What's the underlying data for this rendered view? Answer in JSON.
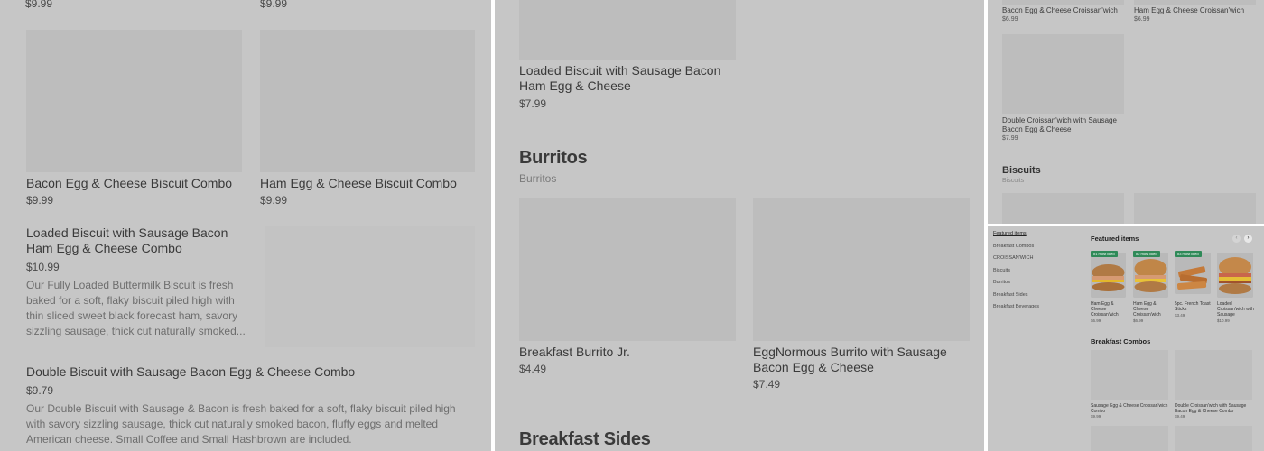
{
  "panel1": {
    "top_prices": [
      "$9.99",
      "$9.99"
    ],
    "items": [
      {
        "name": "Bacon Egg & Cheese Biscuit Combo",
        "price": "$9.99"
      },
      {
        "name": "Ham Egg & Cheese Biscuit Combo",
        "price": "$9.99"
      },
      {
        "name": "Loaded Biscuit with Sausage Bacon Ham Egg & Cheese Combo",
        "price": "$10.99",
        "desc": "Our Fully Loaded Buttermilk Biscuit is fresh baked for a soft, flaky biscuit piled high with thin sliced sweet black forecast ham, savory sizzling sausage, thick cut naturally smoked..."
      },
      {
        "name": "Double Biscuit with Sausage Bacon Egg & Cheese Combo",
        "price": "$9.79",
        "desc": "Our Double Biscuit with Sausage & Bacon is fresh baked for a soft, flaky biscuit piled high with savory sizzling sausage, thick cut naturally smoked bacon, fluffy eggs and melted American cheese. Small Coffee and Small Hashbrown are included."
      }
    ]
  },
  "panel2": {
    "top_item": {
      "name": "Loaded Biscuit with Sausage Bacon Ham Egg & Cheese",
      "price": "$7.99"
    },
    "section_burritos": {
      "title": "Burritos",
      "subtitle": "Burritos"
    },
    "burritos": [
      {
        "name": "Breakfast Burrito Jr.",
        "price": "$4.49"
      },
      {
        "name": "EggNormous Burrito with Sausage Bacon Egg & Cheese",
        "price": "$7.49"
      }
    ],
    "section_sides": {
      "title": "Breakfast Sides"
    }
  },
  "panel3": {
    "top_items": [
      {
        "name": "Bacon Egg & Cheese Croissan'wich",
        "price": "$6.99"
      },
      {
        "name": "Ham Egg & Cheese Croissan'wich",
        "price": "$6.99"
      }
    ],
    "item": {
      "name": "Double Croissan'wich with Sausage Bacon Egg & Cheese",
      "price": "$7.99"
    },
    "section_biscuits": {
      "title": "Biscuits",
      "subtitle": "Biscuits"
    }
  },
  "panel4": {
    "nav": [
      "Featured items",
      "Breakfast Combos",
      "CROISSAN'WICH",
      "Biscuits",
      "Burritos",
      "Breakfast Sides",
      "Breakfast Beverages"
    ],
    "featured_title": "Featured items",
    "featured": [
      {
        "badge": "#1 most liked",
        "name": "Ham Egg & Cheese Croissan'wich",
        "price": "$6.99"
      },
      {
        "badge": "#2 most liked",
        "name": "Ham Egg & Cheese Croissan'wich",
        "price": "$6.99"
      },
      {
        "badge": "#3 most liked",
        "name": "5pc. French Toast Sticks",
        "price": "$3.49"
      },
      {
        "name": "Loaded Croissan'wich with Sausage",
        "price": "$10.99"
      }
    ],
    "combos_title": "Breakfast Combos",
    "combos": [
      {
        "name": "Sausage Egg & Cheese Croissan'wich Combo",
        "price": "$9.99"
      },
      {
        "name": "Double Croissan'wich with Sausage Bacon Egg & Cheese Combo",
        "price": "$9.49"
      }
    ],
    "prev_icon": "chevron-left-icon",
    "next_icon": "chevron-right-icon"
  }
}
